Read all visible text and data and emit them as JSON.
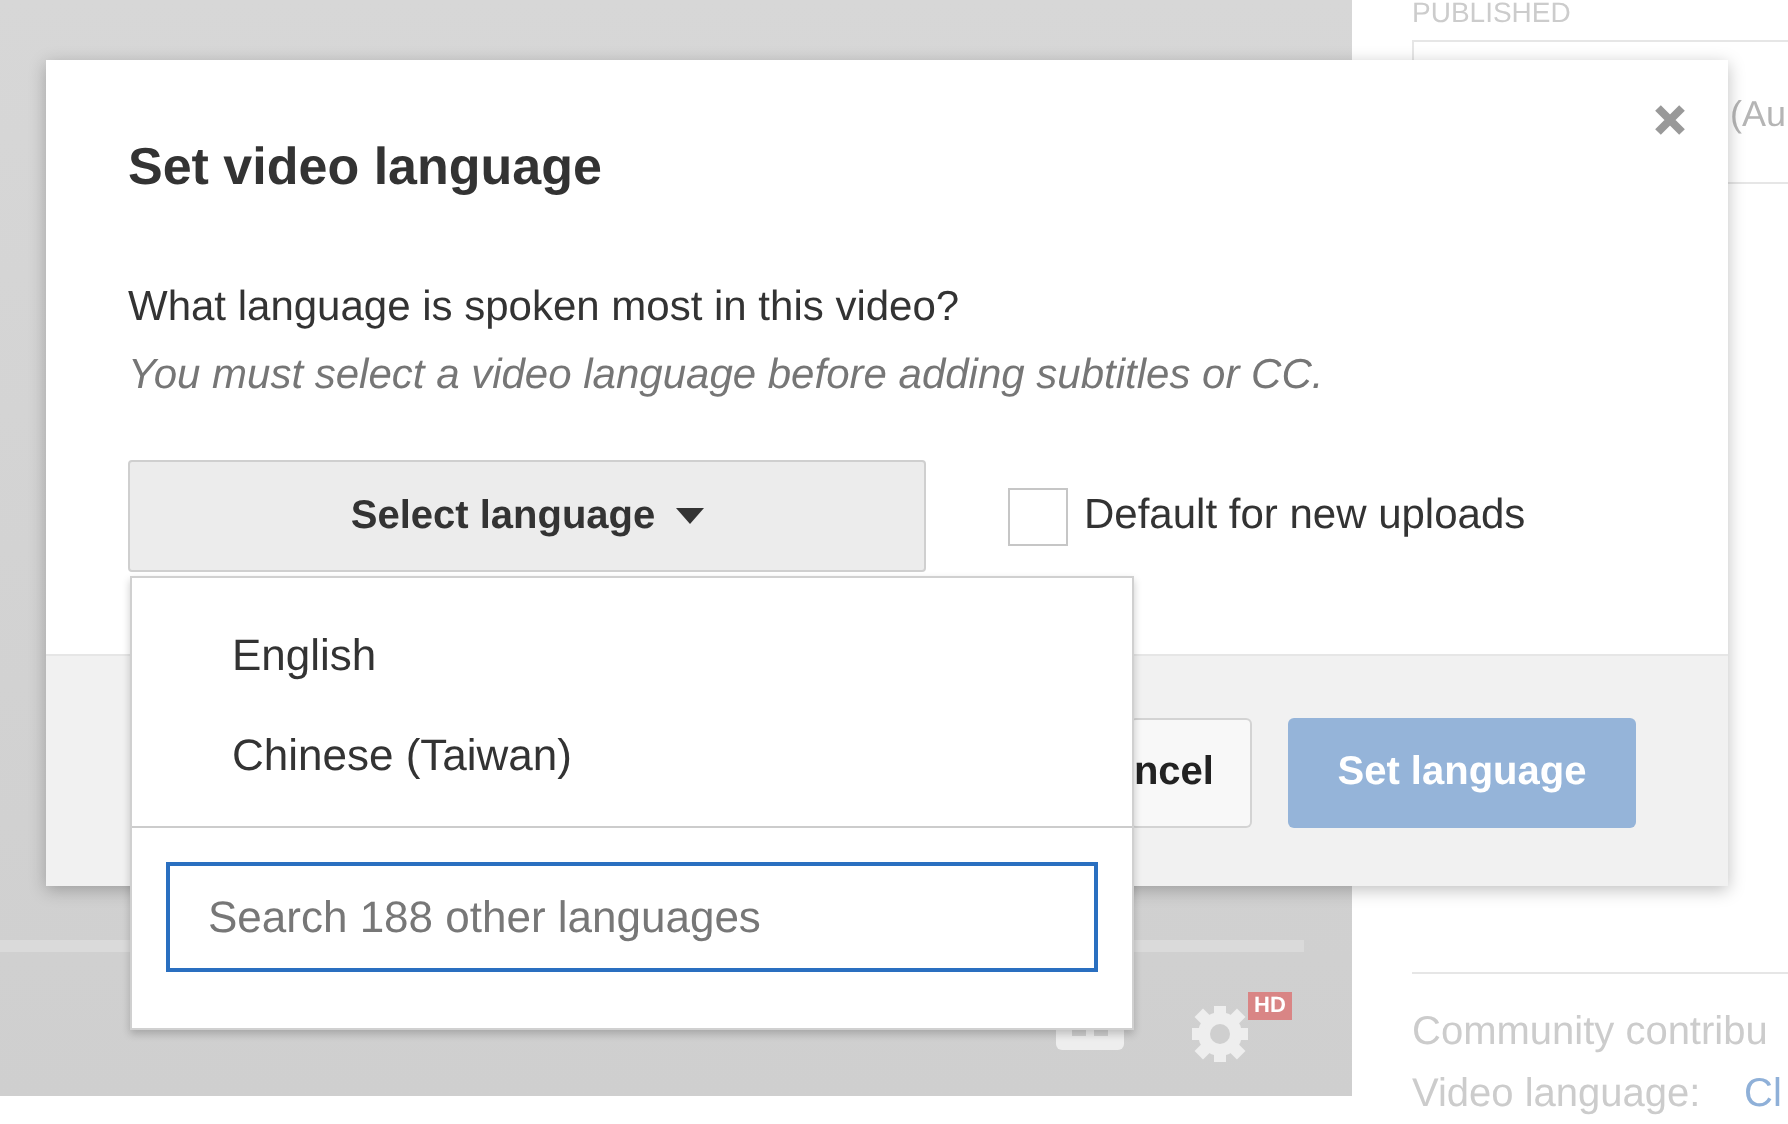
{
  "background": {
    "published_label": "PUBLISHED",
    "field_text": "(Au",
    "community_label": "Community contribu",
    "video_language_label": "Video language:",
    "video_language_value": "Cl",
    "player_badge": "HD"
  },
  "dialog": {
    "title": "Set video language",
    "question": "What language is spoken most in this video?",
    "hint": "You must select a video language before adding subtitles or CC.",
    "select_button": "Select language",
    "default_checkbox": {
      "label": "Default for new uploads",
      "checked": false
    },
    "buttons": [
      {
        "label": "ncel",
        "kind": "secondary",
        "disabled": false
      },
      {
        "label": "Set language",
        "kind": "primary",
        "disabled": true
      }
    ]
  },
  "dropdown": {
    "options": [
      {
        "label": "English"
      },
      {
        "label": "Chinese (Taiwan)"
      }
    ],
    "search": {
      "placeholder": "Search 188 other languages"
    }
  }
}
